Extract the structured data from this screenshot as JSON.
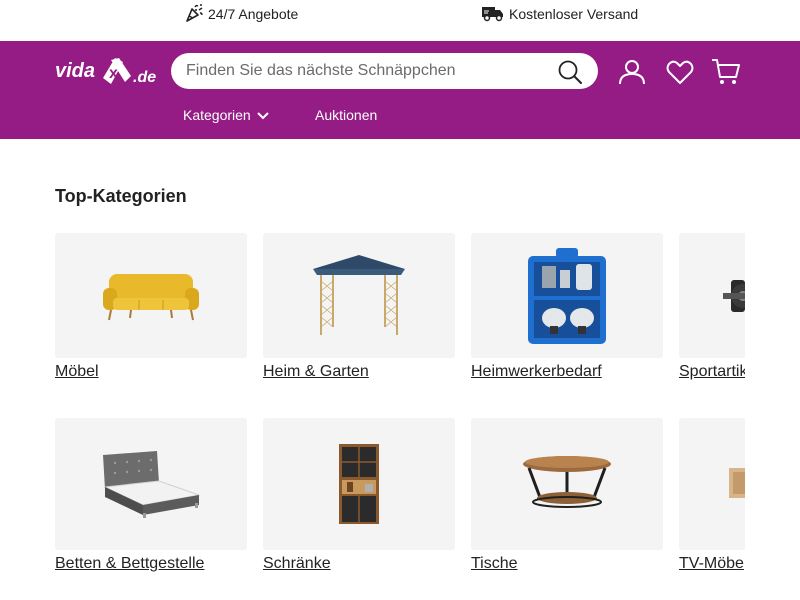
{
  "usp": {
    "offers": "24/7 Angebote",
    "shipping": "Kostenloser Versand"
  },
  "header": {
    "logo_text": "vidaXL.de",
    "search_placeholder": "Finden Sie das nächste Schnäppchen",
    "nav": {
      "categories": "Kategorien",
      "auctions": "Auktionen"
    }
  },
  "section": {
    "title": "Top-Kategorien",
    "categories_row1": [
      {
        "label": "Möbel",
        "icon": "sofa-image"
      },
      {
        "label": "Heim & Garten",
        "icon": "gazebo-image"
      },
      {
        "label": "Heimwerkerbedarf",
        "icon": "spray-gun-kit-image"
      },
      {
        "label": "Sportartik",
        "icon": "sports-equipment-image"
      }
    ],
    "categories_row2": [
      {
        "label": "Betten & Bettgestelle",
        "icon": "bed-image"
      },
      {
        "label": "Schränke",
        "icon": "cabinet-image"
      },
      {
        "label": "Tische",
        "icon": "round-table-image"
      },
      {
        "label": "TV-Möbe",
        "icon": "tv-furniture-image"
      }
    ]
  },
  "colors": {
    "brand": "#941c84",
    "card_bg": "#f4f4f4",
    "text": "#222222"
  }
}
